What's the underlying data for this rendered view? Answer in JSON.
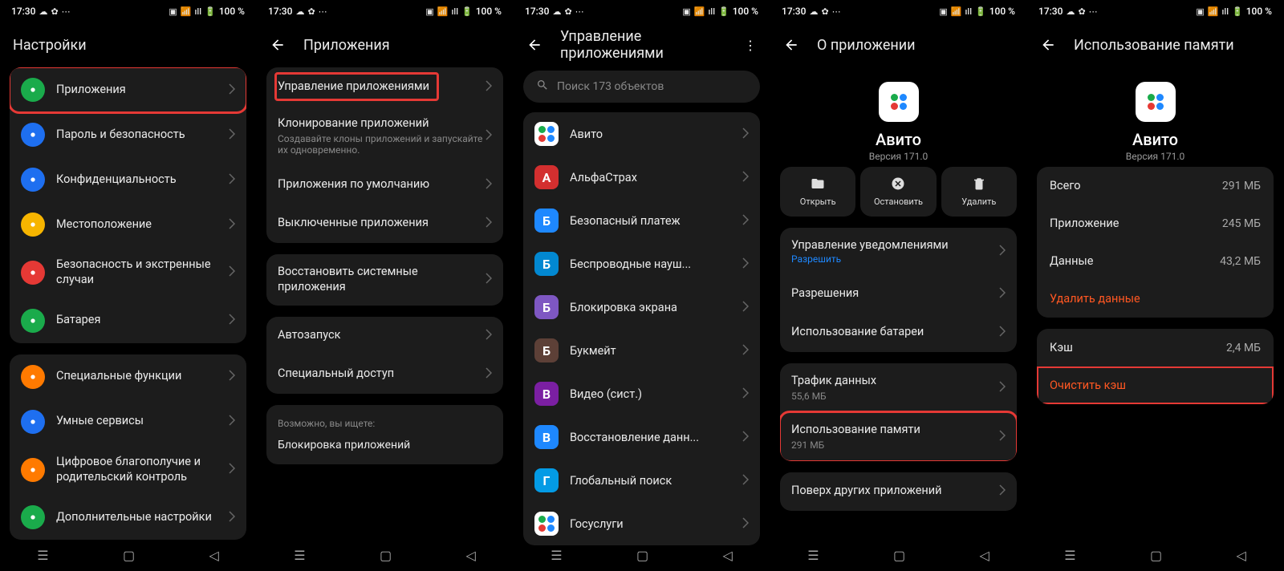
{
  "status": {
    "time": "17:30",
    "battery": "100 %"
  },
  "s1": {
    "title": "Настройки",
    "items1": [
      {
        "label": "Приложения",
        "color": "#1aab4b",
        "hl": true
      },
      {
        "label": "Пароль и безопасность",
        "color": "#1e6ff0"
      },
      {
        "label": "Конфиденциальность",
        "color": "#1e6ff0"
      },
      {
        "label": "Местоположение",
        "color": "#f7b500"
      },
      {
        "label": "Безопасность и экстренные случаи",
        "color": "#e53935"
      },
      {
        "label": "Батарея",
        "color": "#1aab4b"
      }
    ],
    "items2": [
      {
        "label": "Специальные функции",
        "color": "#ff7a00"
      },
      {
        "label": "Умные сервисы",
        "color": "#1e6ff0"
      },
      {
        "label": "Цифровое благополучие и родительский контроль",
        "color": "#ff7a00"
      },
      {
        "label": "Дополнительные настройки",
        "color": "#1aab4b"
      }
    ]
  },
  "s2": {
    "title": "Приложения",
    "g1": [
      {
        "label": "Управление приложениями",
        "hl": true
      },
      {
        "label": "Клонирование приложений",
        "sub": "Создавайте клоны приложений и запускайте их одновременно."
      },
      {
        "label": "Приложения по умолчанию"
      },
      {
        "label": "Выключенные приложения"
      }
    ],
    "g2": [
      {
        "label": "Восстановить системные приложения"
      }
    ],
    "g3": [
      {
        "label": "Автозапуск"
      },
      {
        "label": "Специальный доступ"
      }
    ],
    "hint": {
      "caption": "Возможно, вы ищете:",
      "link": "Блокировка приложений"
    }
  },
  "s3": {
    "title": "Управление приложениями",
    "search": "Поиск 173 объектов",
    "apps": [
      {
        "label": "Авито",
        "bg": "#fff"
      },
      {
        "label": "АльфаСтрах",
        "bg": "#d32f2f"
      },
      {
        "label": "Безопасный платеж",
        "bg": "#1e88ff"
      },
      {
        "label": "Беспроводные науш...",
        "bg": "#0288d1"
      },
      {
        "label": "Блокировка экрана",
        "bg": "#7e57c2"
      },
      {
        "label": "Букмейт",
        "bg": "#5d4037"
      },
      {
        "label": "Видео (сист.)",
        "bg": "#7b1fa2"
      },
      {
        "label": "Восстановление данн...",
        "bg": "#1e88ff"
      },
      {
        "label": "Глобальный поиск",
        "bg": "#039be5"
      },
      {
        "label": "Госуслуги",
        "bg": "#fff"
      }
    ]
  },
  "s4": {
    "title": "О приложении",
    "app": "Авито",
    "ver": "Версия 171.0",
    "actions": [
      {
        "label": "Открыть"
      },
      {
        "label": "Остановить"
      },
      {
        "label": "Удалить"
      }
    ],
    "g1": [
      {
        "label": "Управление уведомлениями",
        "sub": "Разрешить"
      },
      {
        "label": "Разрешения"
      },
      {
        "label": "Использование батареи"
      }
    ],
    "g2": [
      {
        "label": "Трафик данных",
        "sub": "55,6 МБ"
      },
      {
        "label": "Использование памяти",
        "sub": "291 МБ",
        "hl": true
      }
    ],
    "g3": [
      {
        "label": "Поверх других приложений"
      }
    ]
  },
  "s5": {
    "title": "Использование памяти",
    "app": "Авито",
    "ver": "Версия 171.0",
    "g1": [
      {
        "k": "Всего",
        "v": "291 МБ"
      },
      {
        "k": "Приложение",
        "v": "245 МБ"
      },
      {
        "k": "Данные",
        "v": "43,2 МБ"
      },
      {
        "k": "Удалить данные",
        "danger": true
      }
    ],
    "g2": [
      {
        "k": "Кэш",
        "v": "2,4 МБ"
      },
      {
        "k": "Очистить кэш",
        "danger": true,
        "hl": true
      }
    ]
  }
}
